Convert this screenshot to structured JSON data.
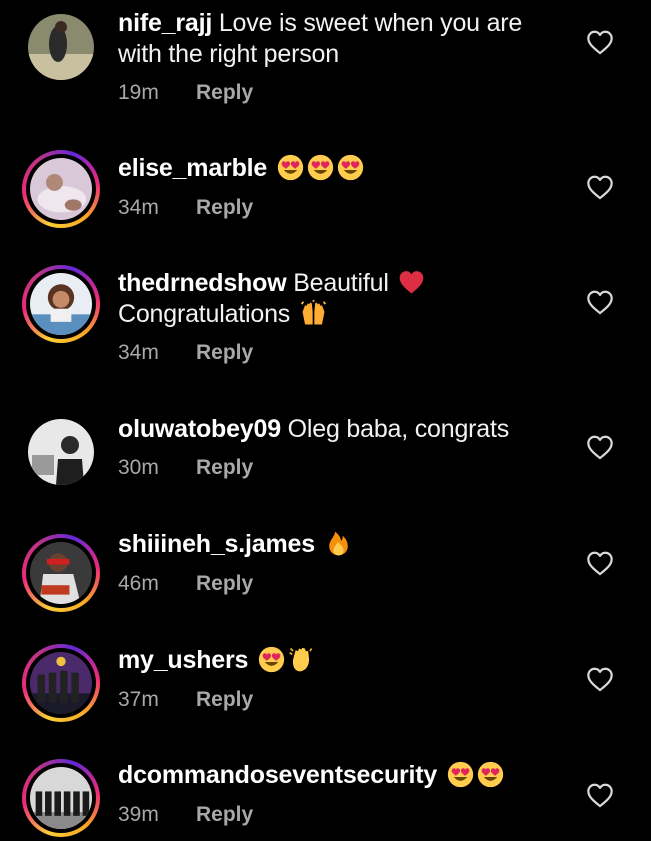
{
  "reply_label": "Reply",
  "comments": [
    {
      "username": "nife_rajj",
      "text": "Love is sweet when you are with the right person",
      "time": "19m",
      "emojis": []
    },
    {
      "username": "elise_marble",
      "text": "",
      "time": "34m",
      "emojis": [
        "heart-eyes",
        "heart-eyes",
        "heart-eyes"
      ]
    },
    {
      "username": "thedrnedshow",
      "text": "Beautiful",
      "text2": "Congratulations",
      "time": "34m",
      "emojis": [
        "red-heart"
      ],
      "emojis2": [
        "raised-hands"
      ]
    },
    {
      "username": "oluwatobey09",
      "text": "Oleg baba, congrats",
      "time": "30m",
      "emojis": []
    },
    {
      "username": "shiiineh_s.james",
      "text": "",
      "time": "46m",
      "emojis": [
        "fire"
      ]
    },
    {
      "username": "my_ushers",
      "text": "",
      "time": "37m",
      "emojis": [
        "heart-eyes",
        "clapping-hands"
      ]
    },
    {
      "username": "dcommandoseventsecurity",
      "text": "",
      "time": "39m",
      "emojis": [
        "heart-eyes",
        "heart-eyes"
      ]
    }
  ],
  "colors": {
    "background": "#000000",
    "text": "#f5f5f5",
    "meta": "#a8a8a8",
    "story_ring_start": "#f9ce34",
    "story_ring_mid": "#ee2a7b",
    "story_ring_end": "#6228d7"
  }
}
